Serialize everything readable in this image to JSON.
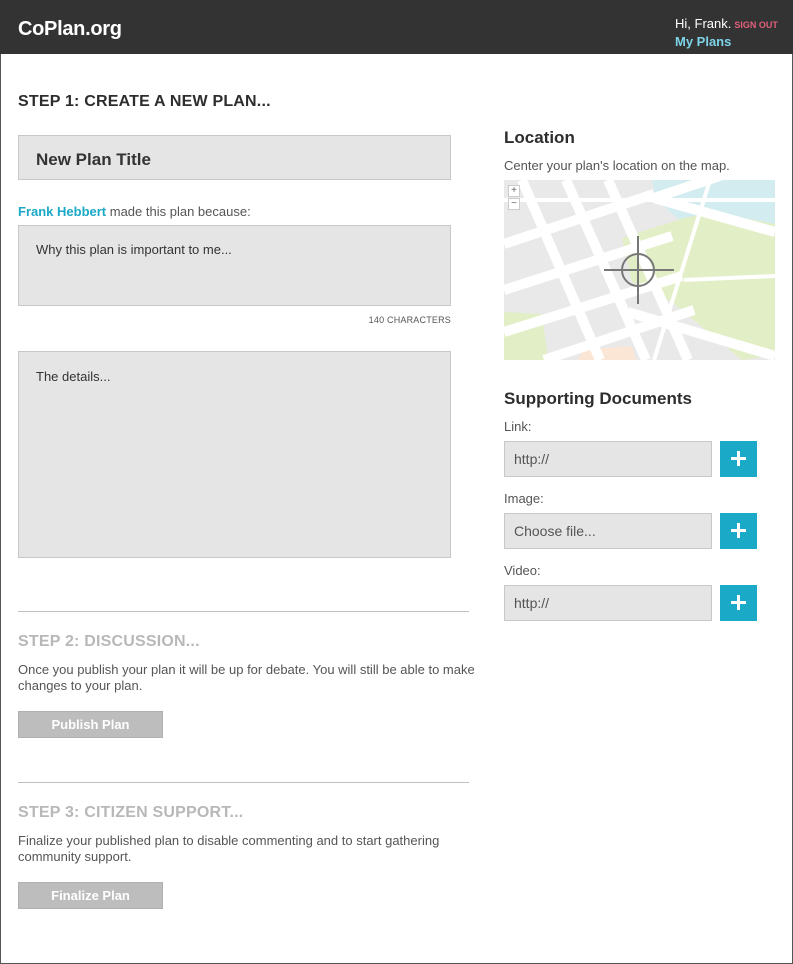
{
  "header": {
    "logo": "CoPlan.org",
    "greeting": "Hi, Frank.",
    "sign_out": "SIGN OUT",
    "my_plans": "My Plans"
  },
  "step1": {
    "title": "STEP 1: CREATE A NEW PLAN...",
    "plan_title_placeholder": "New Plan Title",
    "author": "Frank Hebbert",
    "byline_suffix": " made this plan because:",
    "why_placeholder": "Why this plan is important to me...",
    "char_limit": "140 CHARACTERS",
    "details_placeholder": "The details..."
  },
  "step2": {
    "title": "STEP 2: DISCUSSION...",
    "description": "Once you publish your plan it will be up for debate. You will still be able to make changes to your plan.",
    "button": "Publish Plan"
  },
  "step3": {
    "title": "STEP 3: CITIZEN SUPPORT...",
    "description": "Finalize your published plan to disable commenting and to start gathering community support.",
    "button": "Finalize Plan"
  },
  "location": {
    "title": "Location",
    "hint": "Center your plan's location on the map.",
    "zoom_in": "+",
    "zoom_out": "−"
  },
  "documents": {
    "title": "Supporting Documents",
    "link_label": "Link:",
    "link_placeholder": "http://",
    "image_label": "Image:",
    "image_placeholder": "Choose file...",
    "video_label": "Video:",
    "video_placeholder": "http://"
  },
  "colors": {
    "header_bg": "#333333",
    "accent": "#1aa9c7",
    "sign_out": "#e0607a",
    "my_plans": "#7dd3e8",
    "disabled_button": "#bdbdbd"
  },
  "icons": [
    "crosshair-icon",
    "plus-icon",
    "zoom-in-icon",
    "zoom-out-icon"
  ]
}
